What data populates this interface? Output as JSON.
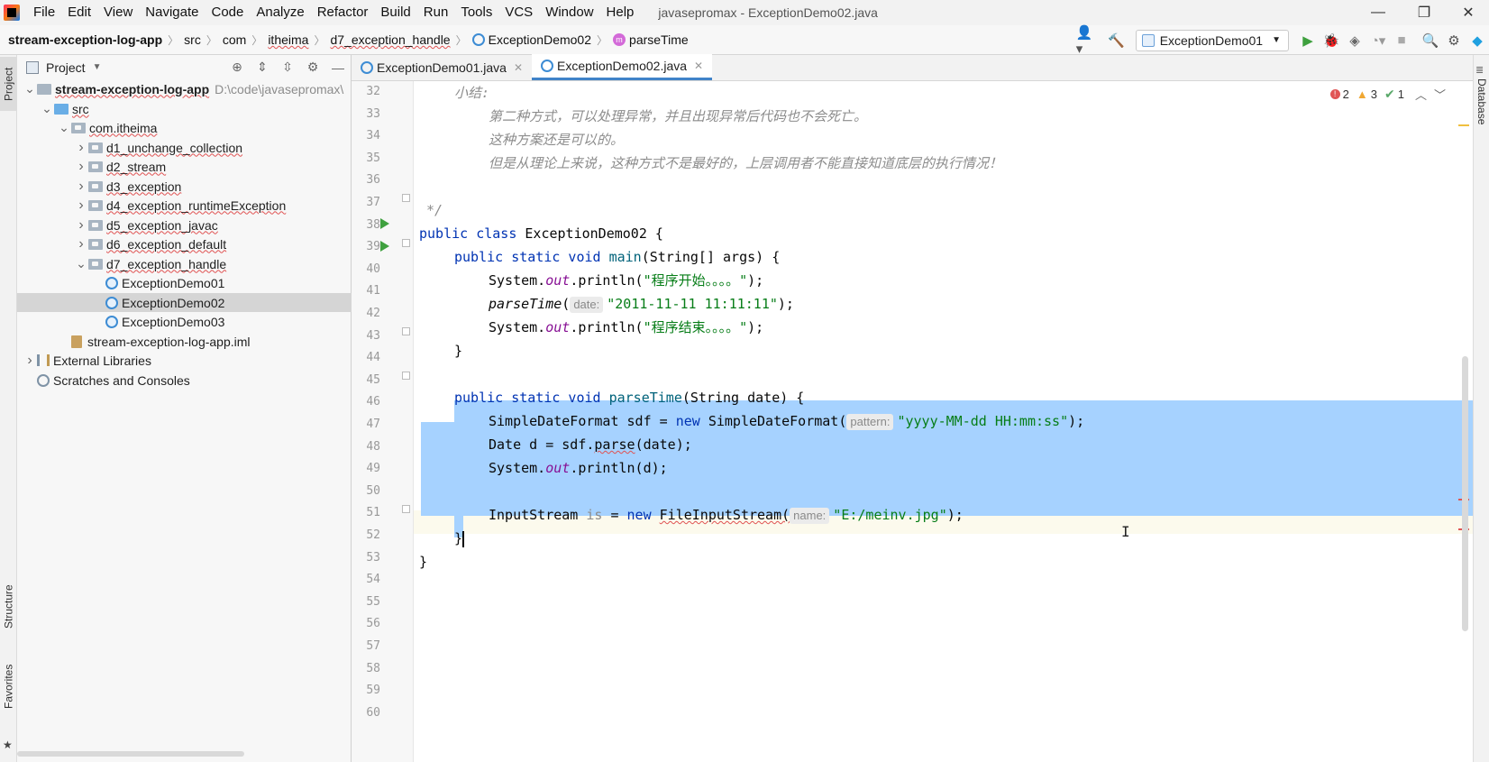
{
  "menu": {
    "items": [
      "File",
      "Edit",
      "View",
      "Navigate",
      "Code",
      "Analyze",
      "Refactor",
      "Build",
      "Run",
      "Tools",
      "VCS",
      "Window",
      "Help"
    ],
    "window_title": "javasepromax - ExceptionDemo02.java",
    "controls": [
      "—",
      "❐",
      "✕"
    ]
  },
  "breadcrumb": {
    "items": [
      "stream-exception-log-app",
      "src",
      "com",
      "itheima",
      "d7_exception_handle",
      "ExceptionDemo02",
      "parseTime"
    ]
  },
  "toolbar": {
    "run_config": "ExceptionDemo01"
  },
  "side_strips": {
    "left_top": "Project",
    "left_mid": "Structure",
    "left_bottom": "Favorites",
    "right": "Database"
  },
  "project_panel": {
    "title": "Project",
    "tree": [
      {
        "label": "stream-exception-log-app",
        "path": "D:\\code\\javasepromax\\",
        "depth": 0,
        "arrow": "down",
        "icon": "module-folder",
        "bold": true
      },
      {
        "label": "src",
        "depth": 1,
        "arrow": "down",
        "icon": "source-folder"
      },
      {
        "label": "com.itheima",
        "depth": 2,
        "arrow": "down",
        "icon": "package"
      },
      {
        "label": "d1_unchange_collection",
        "depth": 3,
        "arrow": "right",
        "icon": "package"
      },
      {
        "label": "d2_stream",
        "depth": 3,
        "arrow": "right",
        "icon": "package"
      },
      {
        "label": "d3_exception",
        "depth": 3,
        "arrow": "right",
        "icon": "package"
      },
      {
        "label": "d4_exception_runtimeException",
        "depth": 3,
        "arrow": "right",
        "icon": "package"
      },
      {
        "label": "d5_exception_javac",
        "depth": 3,
        "arrow": "right",
        "icon": "package"
      },
      {
        "label": "d6_exception_default",
        "depth": 3,
        "arrow": "right",
        "icon": "package"
      },
      {
        "label": "d7_exception_handle",
        "depth": 3,
        "arrow": "down",
        "icon": "package"
      },
      {
        "label": "ExceptionDemo01",
        "depth": 4,
        "arrow": "none",
        "icon": "class"
      },
      {
        "label": "ExceptionDemo02",
        "depth": 4,
        "arrow": "none",
        "icon": "class",
        "selected": true
      },
      {
        "label": "ExceptionDemo03",
        "depth": 4,
        "arrow": "none",
        "icon": "class"
      },
      {
        "label": "stream-exception-log-app.iml",
        "depth": 2,
        "arrow": "none",
        "icon": "iml-file"
      },
      {
        "label": "External Libraries",
        "depth": 0,
        "arrow": "right",
        "icon": "libraries"
      },
      {
        "label": "Scratches and Consoles",
        "depth": 0,
        "arrow": "none",
        "icon": "scratches"
      }
    ]
  },
  "tabs": [
    {
      "label": "ExceptionDemo01.java",
      "active": false
    },
    {
      "label": "ExceptionDemo02.java",
      "active": true
    }
  ],
  "inspections": {
    "errors": "2",
    "warnings": "3",
    "weak_warnings": "1"
  },
  "editor": {
    "line_numbers": [
      "32",
      "33",
      "34",
      "35",
      "36",
      "37",
      "38",
      "39",
      "40",
      "41",
      "42",
      "43",
      "44",
      "45",
      "46",
      "47",
      "48",
      "49",
      "50",
      "51",
      "52",
      "53",
      "54",
      "55",
      "56",
      "57",
      "58",
      "59",
      "60"
    ],
    "lines": {
      "l32": "小结:",
      "l33": "第二种方式，可以处理异常，并且出现异常后代码也不会死亡。",
      "l34": "这种方案还是可以的。",
      "l35": "但是从理论上来说，这种方式不是最好的，上层调用者不能直接知道底层的执行情况！",
      "l37": "*/",
      "l38_kw": "public class",
      "l38_name": " ExceptionDemo02 {",
      "l39_kw": "public static void",
      "l39_name": "main",
      "l39_rest": "(String[] args) {",
      "l40_a": "System.",
      "l40_f": "out",
      "l40_b": ".println(",
      "l40_s": "\"程序开始。。。。\"",
      "l40_c": ");",
      "l41_m": "parseTime",
      "l41_p": "(",
      "l41_hint": "date:",
      "l41_s": "\"2011-11-11 11:11:11\"",
      "l41_c": ");",
      "l42_a": "System.",
      "l42_f": "out",
      "l42_b": ".println(",
      "l42_s": "\"程序结束。。。。\"",
      "l42_c": ");",
      "l43": "}",
      "l45_kw": "public static void",
      "l45_name": "parseTime",
      "l45_rest": "(String date) {",
      "l46_a": "SimpleDateFormat sdf = ",
      "l46_kw": "new",
      "l46_b": " SimpleDateFormat(",
      "l46_hint": "pattern:",
      "l46_s": "\"yyyy-MM-dd HH:mm:ss\"",
      "l46_c": ");",
      "l47_a": "Date d = sdf.",
      "l47_m": "parse",
      "l47_b": "(date);",
      "l48_a": "System.",
      "l48_f": "out",
      "l48_b": ".println(d);",
      "l50_a": "InputStream ",
      "l50_var": "is",
      "l50_b": " = ",
      "l50_kw": "new",
      "l50_cls": "FileInputStream(",
      "l50_hint": "name:",
      "l50_s": "\"E:/meinv.jpg\"",
      "l50_c": ");",
      "l51": "}",
      "l52": "}"
    }
  }
}
